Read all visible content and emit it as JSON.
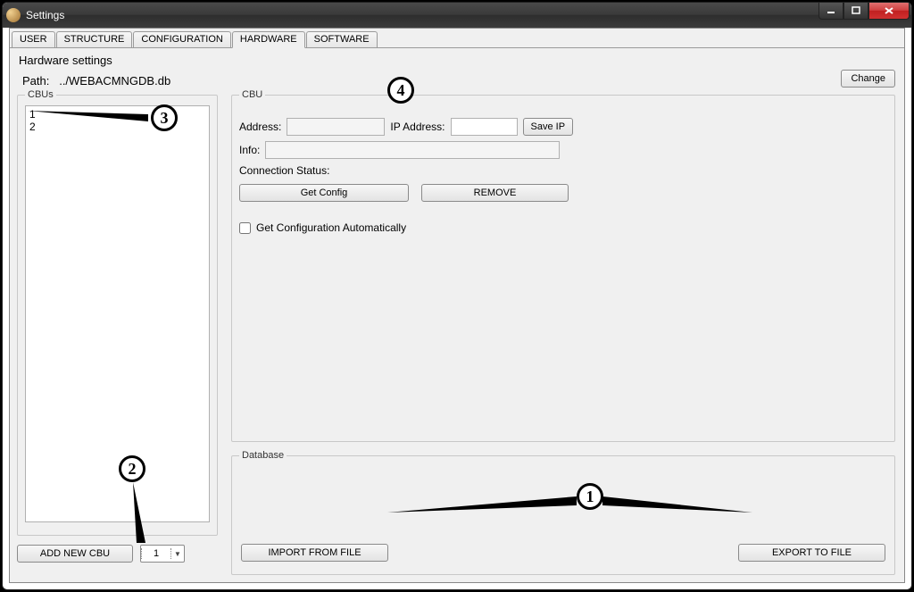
{
  "window": {
    "title": "Settings"
  },
  "tabs": {
    "user": "USER",
    "structure": "STRUCTURE",
    "configuration": "CONFIGURATION",
    "hardware": "HARDWARE",
    "software": "SOFTWARE"
  },
  "page": {
    "title": "Hardware settings",
    "path_label": "Path:",
    "path_value": "../WEBACMNGDB.db",
    "change": "Change"
  },
  "cbus": {
    "legend": "CBUs",
    "items": [
      "1",
      "2"
    ],
    "add_new": "ADD NEW CBU",
    "spinner_value": "1"
  },
  "cbu": {
    "legend": "CBU",
    "address_label": "Address:",
    "address_value": "",
    "ip_label": "IP Address:",
    "ip_value": "",
    "save_ip": "Save IP",
    "info_label": "Info:",
    "info_value": "",
    "conn_status_label": "Connection Status:",
    "get_config": "Get Config",
    "remove": "REMOVE",
    "auto_cfg": "Get Configuration Automatically"
  },
  "db": {
    "legend": "Database",
    "import": "IMPORT FROM FILE",
    "export": "EXPORT TO FILE"
  },
  "annotations": {
    "c1": "1",
    "c2": "2",
    "c3": "3",
    "c4": "4"
  }
}
